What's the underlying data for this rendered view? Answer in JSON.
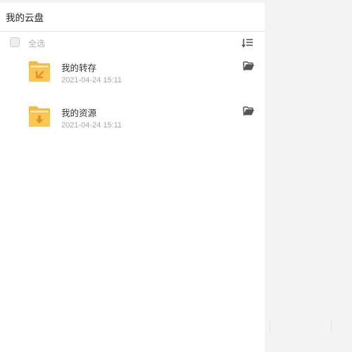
{
  "header": {
    "title": "我的云盘"
  },
  "toolbar": {
    "select_all_label": "全选",
    "select_all_checked": false,
    "sort_icon": "sort-icon"
  },
  "items": [
    {
      "name": "我的转存",
      "date": "2021-04-24 15:11",
      "icon": "folder-transfer-icon",
      "action_icon": "open-folder-icon"
    },
    {
      "name": "我的资源",
      "date": "2021-04-24 15:11",
      "icon": "folder-download-icon",
      "action_icon": "open-folder-icon"
    }
  ],
  "colors": {
    "folder": "#f8b83b",
    "folder_light": "#fcd176",
    "icon_gray": "#555555"
  }
}
